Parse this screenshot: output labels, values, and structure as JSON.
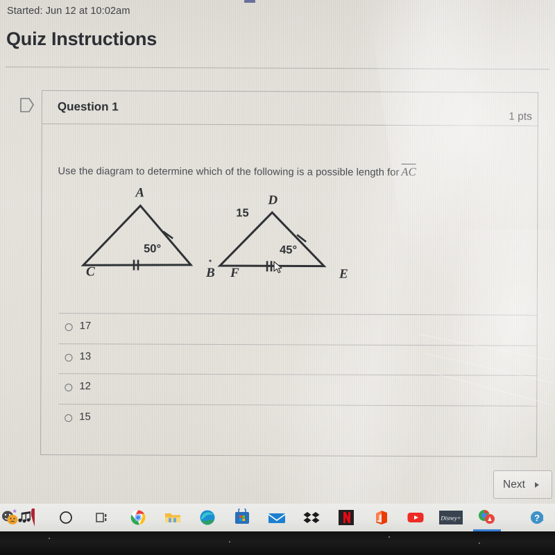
{
  "header": {
    "started_text": "Started: Jun 12 at 10:02am",
    "title": "Quiz Instructions"
  },
  "question": {
    "flag_icon": "flag-outline-icon",
    "title": "Question 1",
    "points": "1 pts",
    "prompt": "Use the diagram to determine which of the following is a possible length for",
    "prompt_segment": "AC"
  },
  "diagram": {
    "type": "two-triangles",
    "triangle_1": {
      "name": "ABC",
      "vertex_labels": [
        "A",
        "C",
        "B"
      ],
      "angle_label": "50°",
      "angle_at": "B",
      "tick_single_side": "AB",
      "tick_double_side": "CB"
    },
    "triangle_2": {
      "name": "DEF",
      "vertex_labels": [
        "D",
        "F",
        "E"
      ],
      "side_length_label": "15",
      "side_length_on": "DF",
      "angle_label": "45°",
      "angle_at": "E",
      "tick_single_side": "DE",
      "tick_double_side": "FE"
    }
  },
  "answers": {
    "options": [
      {
        "label": "17",
        "selected": false
      },
      {
        "label": "13",
        "selected": false
      },
      {
        "label": "12",
        "selected": false
      },
      {
        "label": "15",
        "selected": false
      }
    ]
  },
  "footer": {
    "next_label": "Next",
    "next_arrow_icon": "chevron-right-icon"
  },
  "taskbar": {
    "items": [
      {
        "name": "theater-masks-music-icon",
        "label": ""
      },
      {
        "name": "cortana-circle-icon",
        "label": ""
      },
      {
        "name": "task-view-icon",
        "label": ""
      },
      {
        "name": "google-chrome-icon",
        "label": ""
      },
      {
        "name": "file-explorer-icon",
        "label": ""
      },
      {
        "name": "microsoft-edge-icon",
        "label": ""
      },
      {
        "name": "microsoft-store-icon",
        "label": ""
      },
      {
        "name": "mail-icon",
        "label": ""
      },
      {
        "name": "dropbox-icon",
        "label": ""
      },
      {
        "name": "netflix-icon",
        "label": "N"
      },
      {
        "name": "microsoft-office-icon",
        "label": ""
      },
      {
        "name": "youtube-icon",
        "label": ""
      },
      {
        "name": "disney-plus-icon",
        "label": "Disney+"
      },
      {
        "name": "chrome-app-active-icon",
        "label": ""
      },
      {
        "name": "help-question-icon",
        "label": ""
      }
    ]
  },
  "colors": {
    "page_bg": "#e4e1da",
    "text_primary": "#2e3135",
    "text_secondary": "#4a4d52",
    "border": "#86888a",
    "taskbar_bg": "#e9e9e6",
    "active_accent": "#3a7fd5"
  }
}
